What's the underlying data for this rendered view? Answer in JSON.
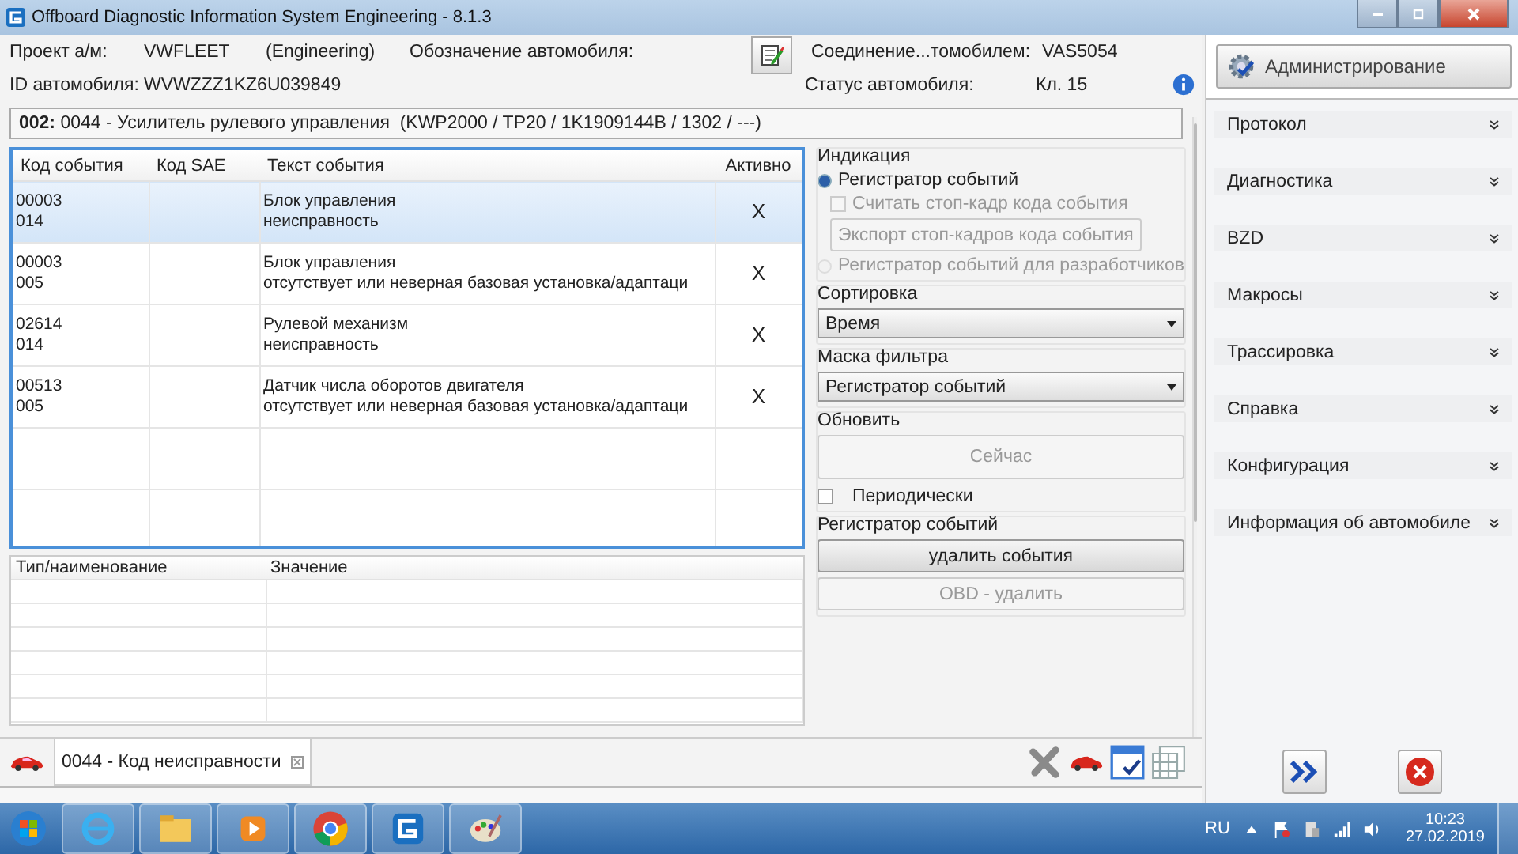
{
  "window": {
    "title": "Offboard Diagnostic Information System Engineering - 8.1.3"
  },
  "header": {
    "project_label": "Проект а/м:",
    "project_value": "VWFLEET",
    "project_mode": "(Engineering)",
    "designation_label": "Обозначение автомобиля:",
    "vin_label": "ID автомобиля:",
    "vin_value": "WVWZZZ1KZ6U039849",
    "connection_label": "Соединение...томобилем:",
    "connection_value": "VAS5054",
    "status_label": "Статус автомобиля:",
    "status_value": "Кл. 15"
  },
  "module": {
    "number": "**002:** 0044 - Усилитель рулевого управления  (KWP2000 / TP20 / 1K1909144B / 1302 / ---)"
  },
  "events": {
    "columns": [
      "Код события",
      "Код SAE",
      "Текст события",
      "Активно"
    ],
    "rows": [
      {
        "code": "00003\n014",
        "sae": "",
        "text": "Блок управления\nнеисправность",
        "active": "X",
        "selected": true
      },
      {
        "code": "00003\n005",
        "sae": "",
        "text": "Блок управления\nотсутствует или неверная базовая установка/адаптаци",
        "active": "X",
        "selected": false
      },
      {
        "code": "02614\n014",
        "sae": "",
        "text": "Рулевой механизм\nнеисправность",
        "active": "X",
        "selected": false
      },
      {
        "code": "00513\n005",
        "sae": "",
        "text": "Датчик числа оборотов двигателя\nотсутствует или неверная базовая установка/адаптаци",
        "active": "X",
        "selected": false
      }
    ]
  },
  "controls": {
    "indication_label": "Индикация",
    "radio_log": {
      "label": "Регистратор событий",
      "selected": true,
      "disabled": false
    },
    "freeze_frame": {
      "label": "Считать стоп-кадр кода события",
      "checked": false,
      "disabled": true
    },
    "export_button": {
      "label": "Экспорт стоп-кадров кода события",
      "disabled": true
    },
    "radio_dev": {
      "label": "Регистратор событий для разработчиков",
      "selected": false,
      "disabled": true
    },
    "sort": {
      "label": "Сортировка",
      "value": "Время"
    },
    "filter": {
      "label": "Маска фильтра",
      "value": "Регистратор событий"
    },
    "refresh_label": "Обновить",
    "now_button": {
      "label": "Сейчас",
      "disabled": true
    },
    "periodic": {
      "label": "Периодически",
      "checked": false,
      "disabled": false
    },
    "log_label": "Регистратор событий",
    "delete_button": {
      "label": "удалить события",
      "disabled": false
    },
    "obd_button": {
      "label": "OBD - удалить",
      "disabled": true
    }
  },
  "details": {
    "columns": [
      "Тип/наименование",
      "Значение"
    ]
  },
  "tabs": [
    {
      "label": "0044 - Код неисправности",
      "selected": true
    }
  ],
  "sidebar": {
    "admin_button": "Администрирование",
    "items": [
      "Протокол",
      "Диагностика",
      "BZD",
      "Макросы",
      "Трассировка",
      "Справка",
      "Конфигурация",
      "Информация об автомобиле"
    ]
  },
  "taskbar": {
    "language": "RU",
    "time": "10:23",
    "date": "27.02.2019"
  }
}
